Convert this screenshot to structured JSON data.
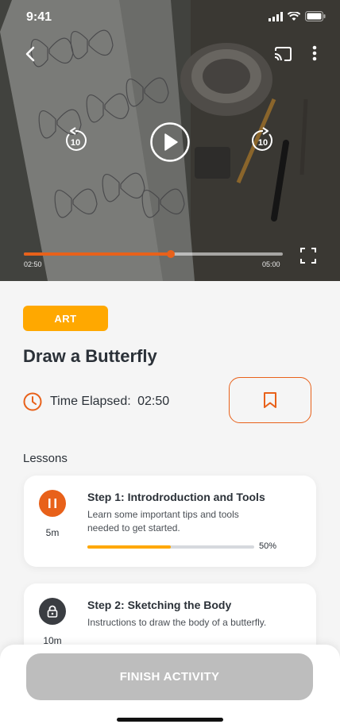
{
  "status_bar": {
    "time": "9:41"
  },
  "video": {
    "elapsed": "02:50",
    "duration": "05:00",
    "progress_fraction": 0.5667,
    "rewind_seconds": "10",
    "forward_seconds": "10"
  },
  "activity": {
    "category": "ART",
    "title": "Draw a Butterfly",
    "time_elapsed_label": "Time Elapsed:",
    "time_elapsed_value": "02:50"
  },
  "lessons": {
    "heading": "Lessons",
    "items": [
      {
        "title": "Step 1: Introdroduction and Tools",
        "description": "Learn some important tips and tools needed to get started.",
        "duration": "5m",
        "progress_percent": 50,
        "progress_label": "50%",
        "icon": "pause-icon"
      },
      {
        "title": "Step 2: Sketching the Body",
        "description": "Instructions to draw the body of a butterfly.",
        "duration": "10m",
        "icon": "lock-icon"
      }
    ]
  },
  "footer": {
    "finish_label": "FINISH ACTIVITY"
  },
  "colors": {
    "accent": "#e8611a",
    "badge": "#ffa800",
    "disabled": "#bdbdbd"
  }
}
